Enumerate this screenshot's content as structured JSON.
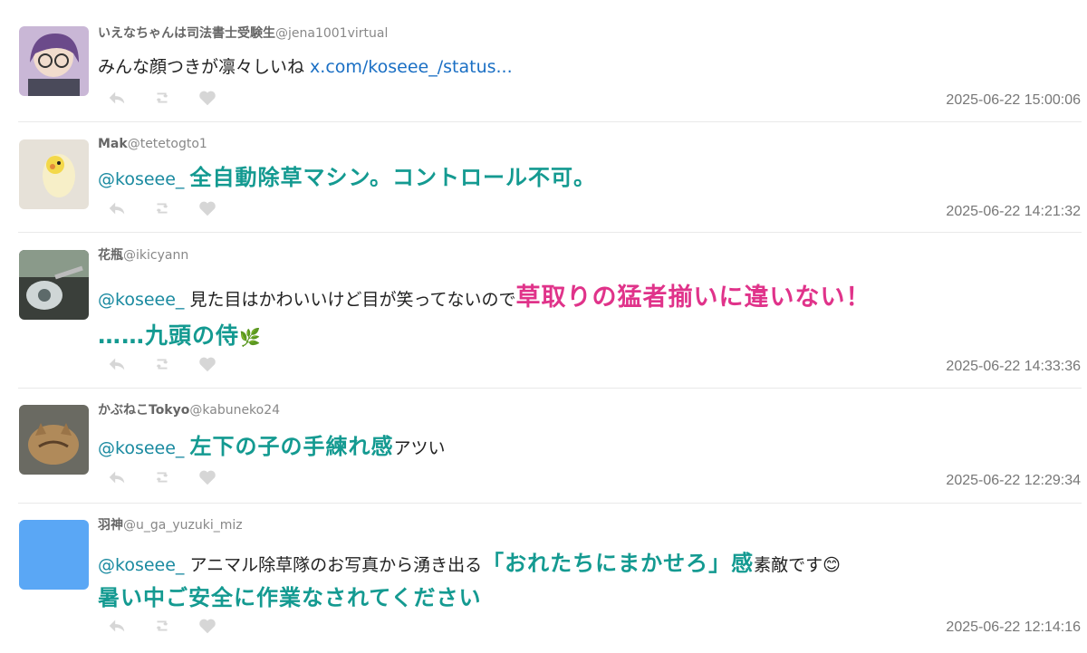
{
  "tweets": [
    {
      "name": "いえなちゃんは司法書士受験生",
      "handle": "@jena1001virtual",
      "text": "みんな顔つきが凛々しいね ",
      "link": "x.com/koseee_/status...",
      "time": "2025-06-22 15:00:06"
    },
    {
      "name": "Mak",
      "handle": "@tetetogto1",
      "mention": "@koseee_ ",
      "em": "全自動除草マシン。コントロール不可。",
      "time": "2025-06-22 14:21:32"
    },
    {
      "name": "花瓶",
      "handle": "@ikicyann",
      "mention": "@koseee_ ",
      "text": "見た目はかわいいけど目が笑ってないので",
      "em_pink": "草取りの猛者揃いに違いない！",
      "em_teal": "……九頭の侍",
      "emoji": "🌿",
      "time": "2025-06-22 14:33:36"
    },
    {
      "name": "かぶねこTokyo",
      "handle": "@kabuneko24",
      "mention": "@koseee_ ",
      "em": "左下の子の手練れ感",
      "text": "アツい",
      "time": "2025-06-22 12:29:34"
    },
    {
      "name": "羽神",
      "handle": "@u_ga_yuzuki_miz",
      "mention": "@koseee_ ",
      "text": "アニマル除草隊のお写真から湧き出る",
      "em": "「おれたちにまかせろ」感",
      "text2": "素敵です",
      "emoji": "😊",
      "em2": "暑い中ご安全に作業なされてください",
      "time": "2025-06-22 12:14:16"
    }
  ],
  "icons": [
    "reply-icon",
    "retweet-icon",
    "like-icon"
  ],
  "colors": {
    "mention": "#1a8aa0",
    "link": "#1a6fc4",
    "teal": "#149a91",
    "pink": "#e0338a",
    "avatar_blue": "#5aa7f5"
  }
}
